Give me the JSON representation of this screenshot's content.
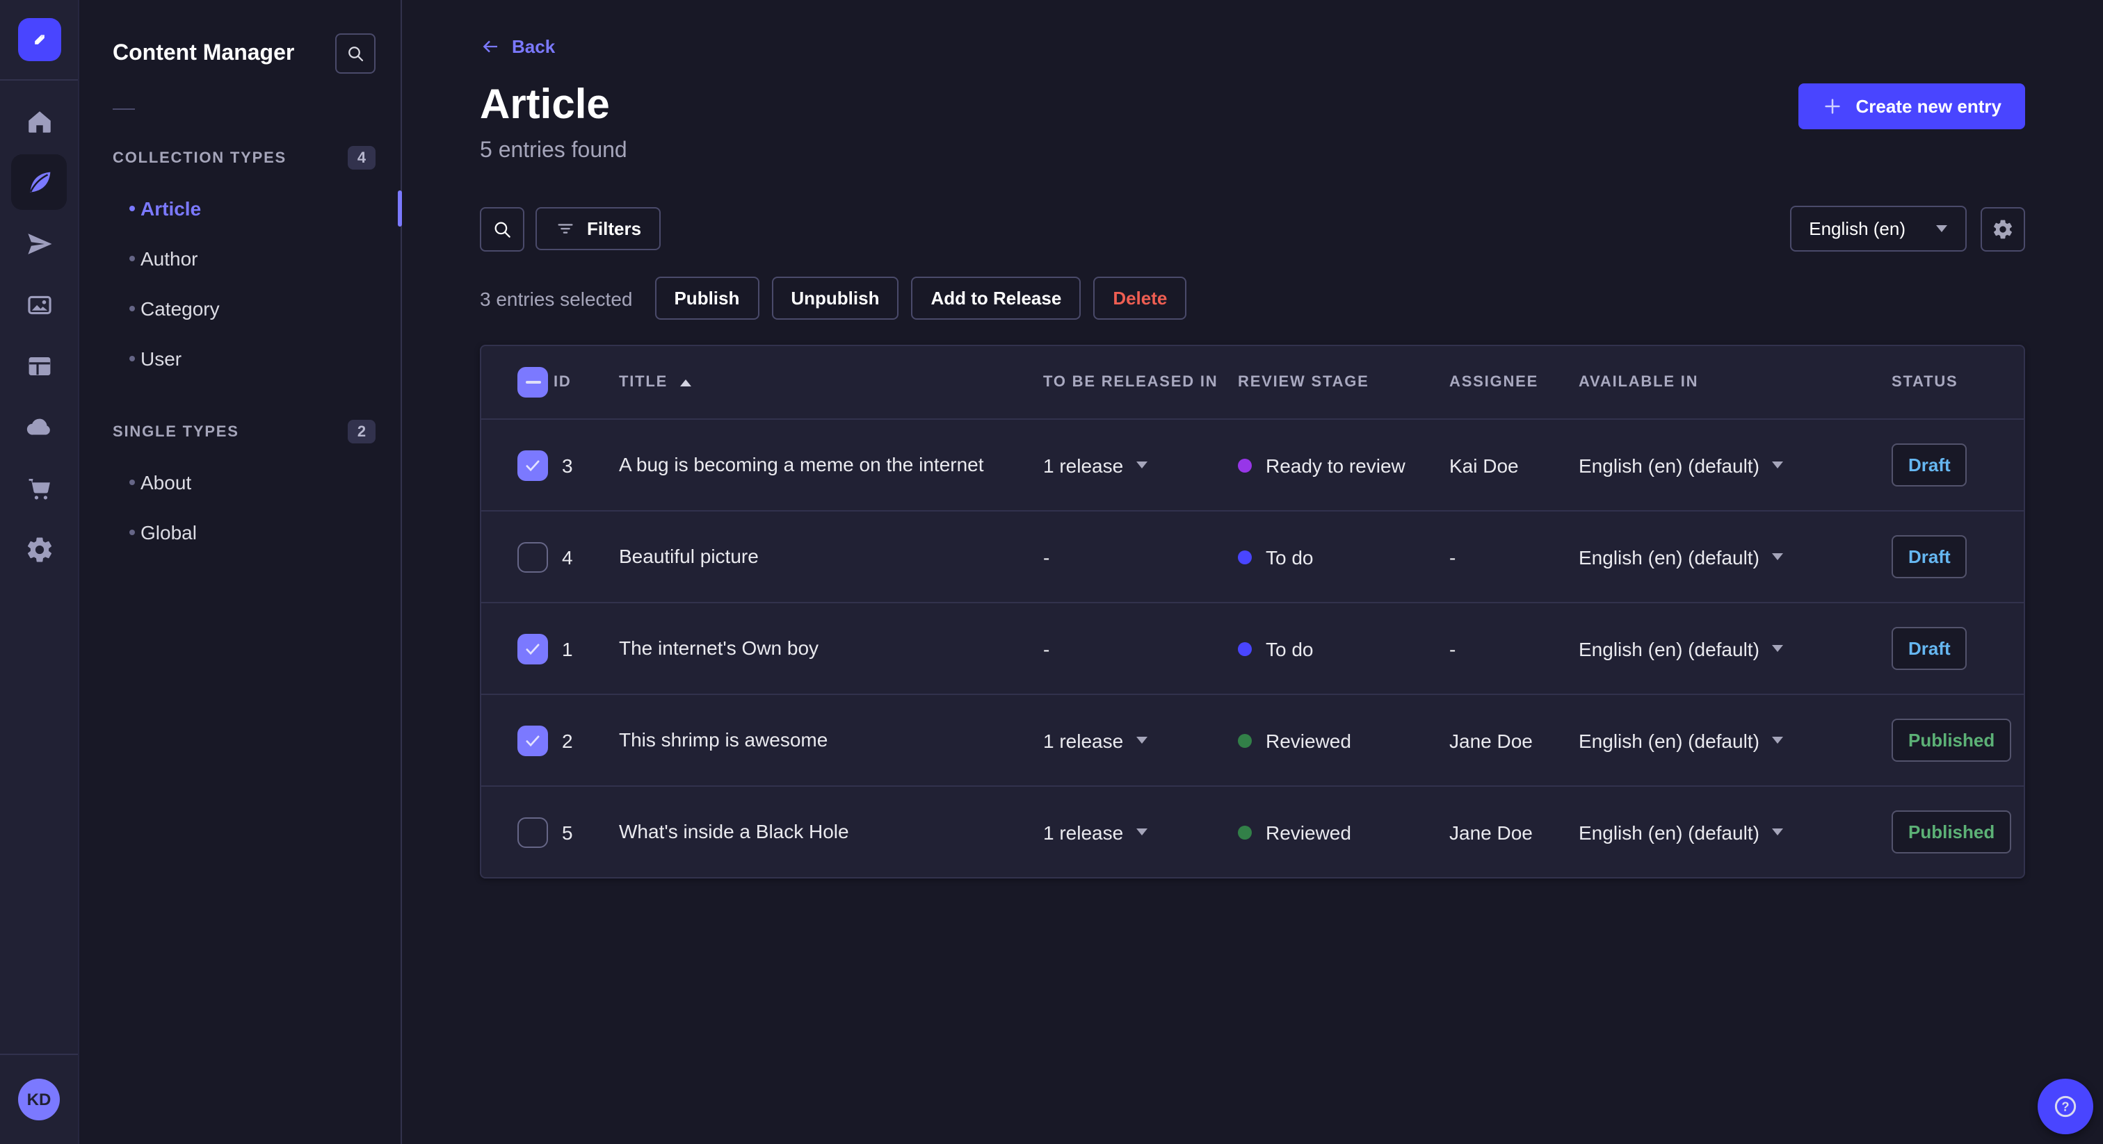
{
  "app": {
    "name": "Content Manager"
  },
  "colors": {
    "accent": "#4945ff",
    "accent_light": "#7b79ff",
    "background": "#181826",
    "surface": "#212134",
    "border": "#32324d",
    "danger": "#ee5e52",
    "draft": "#66b7f1",
    "published": "#5cb176",
    "stage_todo": "#4945ff",
    "stage_ready_to_review": "#9736e8",
    "stage_reviewed": "#328048"
  },
  "nav": {
    "logo_icon": "strapi-logo",
    "icons": [
      "home",
      "content-manager",
      "releases",
      "media-library",
      "content-type-builder",
      "cloud",
      "marketplace",
      "settings"
    ],
    "active_icon": "content-manager",
    "avatar_initials": "KD"
  },
  "subnav": {
    "title": "Content Manager",
    "search_icon": "search-icon",
    "sections": [
      {
        "label": "COLLECTION TYPES",
        "count": "4",
        "items": [
          {
            "label": "Article",
            "active": true
          },
          {
            "label": "Author",
            "active": false
          },
          {
            "label": "Category",
            "active": false
          },
          {
            "label": "User",
            "active": false
          }
        ]
      },
      {
        "label": "SINGLE TYPES",
        "count": "2",
        "items": [
          {
            "label": "About",
            "active": false
          },
          {
            "label": "Global",
            "active": false
          }
        ]
      }
    ]
  },
  "header": {
    "back_label": "Back",
    "title": "Article",
    "subtitle": "5 entries found",
    "create_label": "Create new entry"
  },
  "toolbar": {
    "search_icon": "search-icon",
    "filters_label": "Filters",
    "locale_value": "English (en)",
    "settings_icon": "gear-icon"
  },
  "selection": {
    "label": "3 entries selected",
    "publish_label": "Publish",
    "unpublish_label": "Unpublish",
    "add_to_release_label": "Add to Release",
    "delete_label": "Delete"
  },
  "table": {
    "header_checkbox_state": "indeterminate",
    "sort": {
      "column": "TITLE",
      "direction": "asc"
    },
    "columns": {
      "id": "ID",
      "title": "TITLE",
      "release": "TO BE RELEASED IN",
      "stage": "REVIEW STAGE",
      "assignee": "ASSIGNEE",
      "available": "AVAILABLE IN",
      "status": "STATUS"
    },
    "rows": [
      {
        "checked": true,
        "id": "3",
        "title": "A bug is becoming a meme on the internet",
        "release": "1 release",
        "stage": "Ready to review",
        "stage_color": "#9736e8",
        "assignee": "Kai Doe",
        "available": "English (en) (default)",
        "status": "Draft",
        "status_color": "#66b7f1"
      },
      {
        "checked": false,
        "id": "4",
        "title": "Beautiful picture",
        "release": "-",
        "stage": "To do",
        "stage_color": "#4945ff",
        "assignee": "-",
        "available": "English (en) (default)",
        "status": "Draft",
        "status_color": "#66b7f1"
      },
      {
        "checked": true,
        "id": "1",
        "title": "The internet's Own boy",
        "release": "-",
        "stage": "To do",
        "stage_color": "#4945ff",
        "assignee": "-",
        "available": "English (en) (default)",
        "status": "Draft",
        "status_color": "#66b7f1"
      },
      {
        "checked": true,
        "id": "2",
        "title": "This shrimp is awesome",
        "release": "1 release",
        "stage": "Reviewed",
        "stage_color": "#328048",
        "assignee": "Jane Doe",
        "available": "English (en) (default)",
        "status": "Published",
        "status_color": "#5cb176"
      },
      {
        "checked": false,
        "id": "5",
        "title": "What's inside a Black Hole",
        "release": "1 release",
        "stage": "Reviewed",
        "stage_color": "#328048",
        "assignee": "Jane Doe",
        "available": "English (en) (default)",
        "status": "Published",
        "status_color": "#5cb176"
      }
    ]
  },
  "help": {
    "icon": "question-circle-icon"
  }
}
